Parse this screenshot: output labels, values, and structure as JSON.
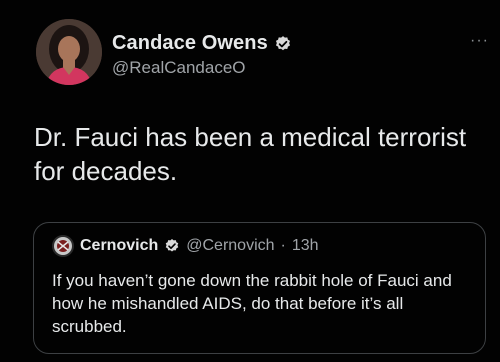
{
  "author": {
    "display_name": "Candace Owens",
    "handle": "@RealCandaceO",
    "verified": true,
    "avatar_icon": "profile-photo-icon"
  },
  "tweet": {
    "text": "Dr. Fauci has been a medical terrorist for decades."
  },
  "quoted_tweet": {
    "display_name": "Cernovich",
    "handle": "@Cernovich",
    "separator": "·",
    "time": "13h",
    "verified": true,
    "text": "If you haven’t gone down the rabbit hole of Fauci and how he mishandled AIDS, do that before it’s all scrubbed."
  },
  "menu": {
    "more_label": "···"
  },
  "colors": {
    "background": "#020202",
    "verified_badge": "#d9d9d9",
    "text_primary": "#e7e9ea",
    "text_secondary": "#a0a4a8",
    "quote_border": "#3d4043"
  }
}
